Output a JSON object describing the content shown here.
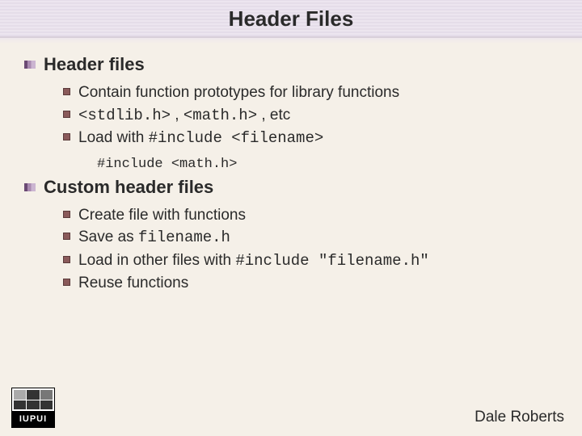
{
  "title": "Header Files",
  "sections": [
    {
      "heading": "Header files",
      "items": [
        {
          "type": "text",
          "text": "Contain function prototypes for library functions"
        },
        {
          "type": "mixed",
          "parts": [
            {
              "mono": true,
              "text": "<stdlib.h>"
            },
            {
              "mono": false,
              "text": " , "
            },
            {
              "mono": true,
              "text": "<math.h>"
            },
            {
              "mono": false,
              "text": " , etc"
            }
          ]
        },
        {
          "type": "mixed",
          "parts": [
            {
              "mono": false,
              "text": "Load with "
            },
            {
              "mono": true,
              "text": "#include <filename>"
            }
          ]
        }
      ],
      "example": "#include <math.h>"
    },
    {
      "heading": "Custom header files",
      "items": [
        {
          "type": "text",
          "text": "Create file with functions"
        },
        {
          "type": "mixed",
          "parts": [
            {
              "mono": false,
              "text": "Save as "
            },
            {
              "mono": true,
              "text": "filename.h"
            }
          ]
        },
        {
          "type": "mixed",
          "parts": [
            {
              "mono": false,
              "text": "Load in other files with "
            },
            {
              "mono": true,
              "text": "#include \"filename.h\""
            }
          ]
        },
        {
          "type": "text",
          "text": "Reuse functions"
        }
      ]
    }
  ],
  "author": "Dale Roberts",
  "logo_text": "IUPUI"
}
